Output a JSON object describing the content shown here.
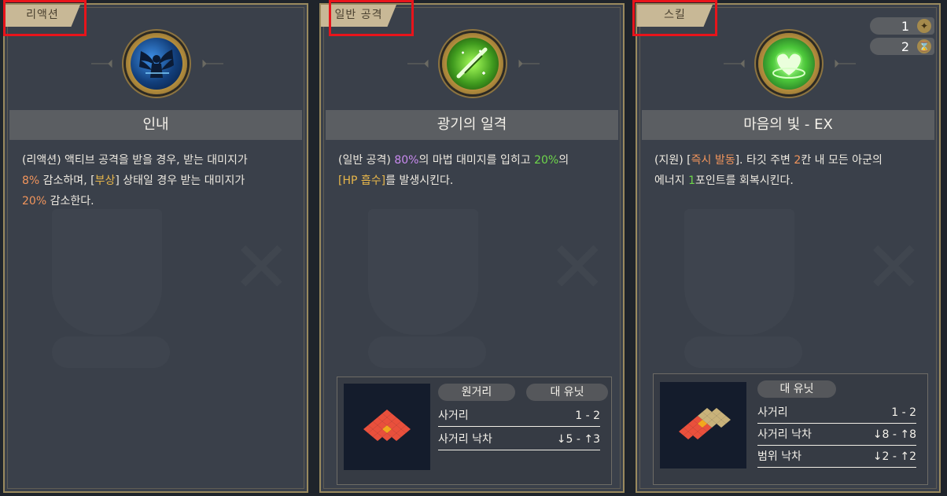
{
  "cards": [
    {
      "tag": "리액션",
      "title": "인내",
      "icon": "winged-figure-icon",
      "desc": [
        [
          {
            "t": "(리액션) 액티브 공격을 받을 경우, 받는 대미지가"
          }
        ],
        [
          {
            "t": "8%",
            "c": "orange"
          },
          {
            "t": " 감소하며, ["
          },
          {
            "t": "부상",
            "c": "gold"
          },
          {
            "t": "] 상태일 경우 받는 대미지가"
          }
        ],
        [
          {
            "t": "20%",
            "c": "orange"
          },
          {
            "t": " 감소한다."
          }
        ]
      ]
    },
    {
      "tag": "일반 공격",
      "title": "광기의 일격",
      "icon": "green-slash-icon",
      "desc": [
        [
          {
            "t": "(일반 공격) "
          },
          {
            "t": "80%",
            "c": "violet"
          },
          {
            "t": "의 마법 대미지를 입히고 "
          },
          {
            "t": "20%",
            "c": "green"
          },
          {
            "t": "의"
          }
        ],
        [
          {
            "t": "[HP 흡수]",
            "c": "gold"
          },
          {
            "t": "를 발생시킨다."
          }
        ]
      ],
      "range": {
        "pills": [
          "원거리",
          "대 유닛"
        ],
        "rows": [
          {
            "label": "사거리",
            "value": "1 - 2"
          },
          {
            "label": "사거리 낙차",
            "value": "↓5 - ↑3"
          }
        ]
      }
    },
    {
      "tag": "스킬",
      "title": "마음의 빛 - EX",
      "icon": "green-heart-icon",
      "counters": [
        {
          "value": "1",
          "icon": "spark-icon",
          "glyph": "✦"
        },
        {
          "value": "2",
          "icon": "hourglass-icon",
          "glyph": "⌛"
        }
      ],
      "desc": [
        [
          {
            "t": "(지원) ["
          },
          {
            "t": "즉시 발동",
            "c": "orange"
          },
          {
            "t": "]. 타깃 주변 "
          },
          {
            "t": "2",
            "c": "orange"
          },
          {
            "t": "칸 내 모든 아군의"
          }
        ],
        [
          {
            "t": "에너지 "
          },
          {
            "t": "1",
            "c": "green"
          },
          {
            "t": "포인트를 회복시킨다."
          }
        ]
      ],
      "range": {
        "pills": [
          "대 유닛"
        ],
        "rows": [
          {
            "label": "사거리",
            "value": "1 - 2"
          },
          {
            "label": "사거리 낙차",
            "value": "↓8 - ↑8"
          },
          {
            "label": "범위 낙차",
            "value": "↓2 - ↑2"
          }
        ]
      }
    }
  ],
  "colors": {
    "orange": "#f0945c",
    "gold": "#e7b64a",
    "violet": "#c98af0",
    "green": "#6ed64a",
    "highlight_box": "#e8141b"
  }
}
